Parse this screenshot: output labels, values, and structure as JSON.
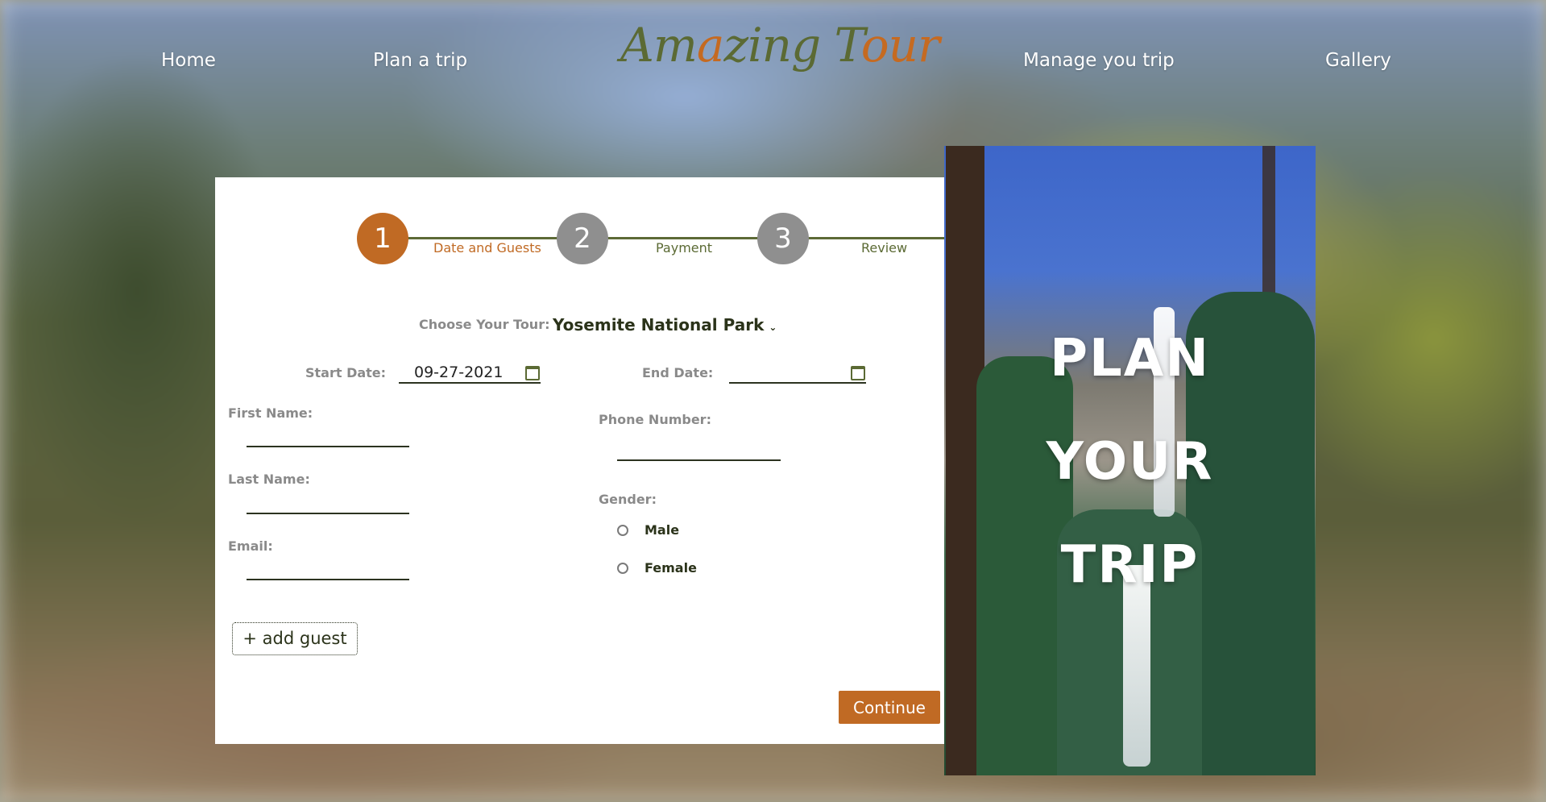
{
  "nav": {
    "home": "Home",
    "plan_trip": "Plan a trip",
    "manage_trip": "Manage you trip",
    "gallery": "Gallery"
  },
  "logo": {
    "part1": "Am",
    "part2": "a",
    "part3": "zing T",
    "part4": "our"
  },
  "colors": {
    "accent": "#c06a24",
    "brand_green": "#5b6a34",
    "step_inactive": "#8f8f8f"
  },
  "steps": [
    {
      "number": "1",
      "label": "Date and Guests",
      "active": true
    },
    {
      "number": "2",
      "label": "Payment",
      "active": false
    },
    {
      "number": "3",
      "label": "Review",
      "active": false
    }
  ],
  "form": {
    "choose_tour_label": "Choose Your Tour:",
    "tour_value": "Yosemite National Park",
    "start_date_label": "Start Date:",
    "start_date_value": "09-27-2021",
    "end_date_label": "End Date:",
    "end_date_value": "",
    "first_name_label": "First Name:",
    "last_name_label": "Last Name:",
    "email_label": "Email:",
    "phone_label": "Phone Number:",
    "gender_label": "Gender:",
    "gender_options": [
      "Male",
      "Female"
    ],
    "add_guest": "+ add guest",
    "continue": "Continue"
  },
  "hero": {
    "line1": "PLAN",
    "line2": "YOUR",
    "line3": "TRIP"
  }
}
